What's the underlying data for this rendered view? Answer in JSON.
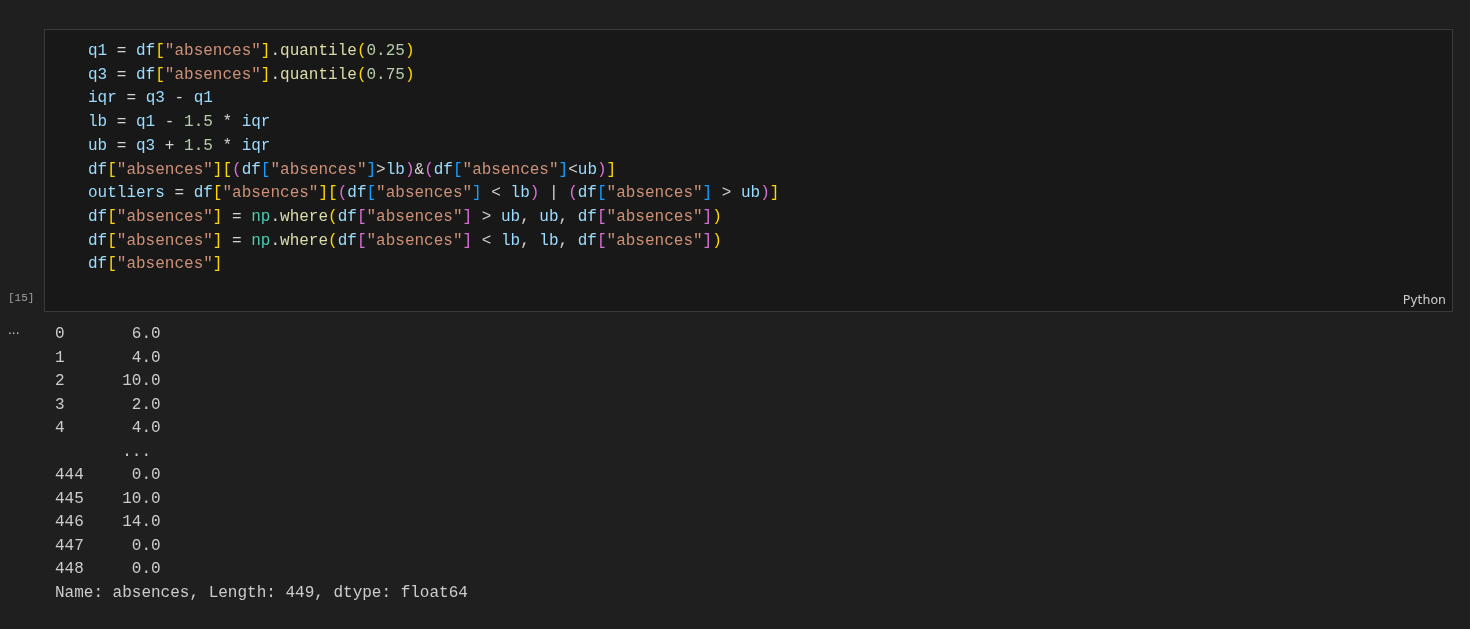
{
  "cell": {
    "execution_count": "[15]",
    "language": "Python",
    "lines": [
      [
        {
          "t": "q1",
          "kind": "name"
        },
        {
          "t": " = ",
          "kind": "op"
        },
        {
          "t": "df",
          "kind": "name"
        },
        {
          "t": "[",
          "kind": "bracket",
          "color": "#ffd700"
        },
        {
          "t": "\"absences\"",
          "kind": "str"
        },
        {
          "t": "]",
          "kind": "bracket",
          "color": "#ffd700"
        },
        {
          "t": ".",
          "kind": "op"
        },
        {
          "t": "quantile",
          "kind": "func"
        },
        {
          "t": "(",
          "kind": "bracket",
          "color": "#ffd700"
        },
        {
          "t": "0.25",
          "kind": "num"
        },
        {
          "t": ")",
          "kind": "bracket",
          "color": "#ffd700"
        }
      ],
      [
        {
          "t": "q3",
          "kind": "name"
        },
        {
          "t": " = ",
          "kind": "op"
        },
        {
          "t": "df",
          "kind": "name"
        },
        {
          "t": "[",
          "kind": "bracket",
          "color": "#ffd700"
        },
        {
          "t": "\"absences\"",
          "kind": "str"
        },
        {
          "t": "]",
          "kind": "bracket",
          "color": "#ffd700"
        },
        {
          "t": ".",
          "kind": "op"
        },
        {
          "t": "quantile",
          "kind": "func"
        },
        {
          "t": "(",
          "kind": "bracket",
          "color": "#ffd700"
        },
        {
          "t": "0.75",
          "kind": "num"
        },
        {
          "t": ")",
          "kind": "bracket",
          "color": "#ffd700"
        }
      ],
      [
        {
          "t": "iqr",
          "kind": "name"
        },
        {
          "t": " = ",
          "kind": "op"
        },
        {
          "t": "q3",
          "kind": "name"
        },
        {
          "t": " - ",
          "kind": "op"
        },
        {
          "t": "q1",
          "kind": "name"
        }
      ],
      [
        {
          "t": "lb",
          "kind": "name"
        },
        {
          "t": " = ",
          "kind": "op"
        },
        {
          "t": "q1",
          "kind": "name"
        },
        {
          "t": " - ",
          "kind": "op"
        },
        {
          "t": "1.5",
          "kind": "num"
        },
        {
          "t": " * ",
          "kind": "op"
        },
        {
          "t": "iqr",
          "kind": "name"
        }
      ],
      [
        {
          "t": "ub",
          "kind": "name"
        },
        {
          "t": " = ",
          "kind": "op"
        },
        {
          "t": "q3",
          "kind": "name"
        },
        {
          "t": " + ",
          "kind": "op"
        },
        {
          "t": "1.5",
          "kind": "num"
        },
        {
          "t": " * ",
          "kind": "op"
        },
        {
          "t": "iqr",
          "kind": "name"
        }
      ],
      [
        {
          "t": "df",
          "kind": "name"
        },
        {
          "t": "[",
          "kind": "bracket",
          "color": "#ffd700"
        },
        {
          "t": "\"absences\"",
          "kind": "str"
        },
        {
          "t": "]",
          "kind": "bracket",
          "color": "#ffd700"
        },
        {
          "t": "[",
          "kind": "bracket",
          "color": "#ffd700"
        },
        {
          "t": "(",
          "kind": "bracket",
          "color": "#da70d6"
        },
        {
          "t": "df",
          "kind": "name"
        },
        {
          "t": "[",
          "kind": "bracket",
          "color": "#179fff"
        },
        {
          "t": "\"absences\"",
          "kind": "str"
        },
        {
          "t": "]",
          "kind": "bracket",
          "color": "#179fff"
        },
        {
          "t": ">",
          "kind": "op"
        },
        {
          "t": "lb",
          "kind": "name"
        },
        {
          "t": ")",
          "kind": "bracket",
          "color": "#da70d6"
        },
        {
          "t": "&",
          "kind": "op"
        },
        {
          "t": "(",
          "kind": "bracket",
          "color": "#da70d6"
        },
        {
          "t": "df",
          "kind": "name"
        },
        {
          "t": "[",
          "kind": "bracket",
          "color": "#179fff"
        },
        {
          "t": "\"absences\"",
          "kind": "str"
        },
        {
          "t": "]",
          "kind": "bracket",
          "color": "#179fff"
        },
        {
          "t": "<",
          "kind": "op"
        },
        {
          "t": "ub",
          "kind": "name"
        },
        {
          "t": ")",
          "kind": "bracket",
          "color": "#da70d6"
        },
        {
          "t": "]",
          "kind": "bracket",
          "color": "#ffd700"
        }
      ],
      [
        {
          "t": "outliers",
          "kind": "name"
        },
        {
          "t": " = ",
          "kind": "op"
        },
        {
          "t": "df",
          "kind": "name"
        },
        {
          "t": "[",
          "kind": "bracket",
          "color": "#ffd700"
        },
        {
          "t": "\"absences\"",
          "kind": "str"
        },
        {
          "t": "]",
          "kind": "bracket",
          "color": "#ffd700"
        },
        {
          "t": "[",
          "kind": "bracket",
          "color": "#ffd700"
        },
        {
          "t": "(",
          "kind": "bracket",
          "color": "#da70d6"
        },
        {
          "t": "df",
          "kind": "name"
        },
        {
          "t": "[",
          "kind": "bracket",
          "color": "#179fff"
        },
        {
          "t": "\"absences\"",
          "kind": "str"
        },
        {
          "t": "]",
          "kind": "bracket",
          "color": "#179fff"
        },
        {
          "t": " < ",
          "kind": "op"
        },
        {
          "t": "lb",
          "kind": "name"
        },
        {
          "t": ")",
          "kind": "bracket",
          "color": "#da70d6"
        },
        {
          "t": " | ",
          "kind": "op"
        },
        {
          "t": "(",
          "kind": "bracket",
          "color": "#da70d6"
        },
        {
          "t": "df",
          "kind": "name"
        },
        {
          "t": "[",
          "kind": "bracket",
          "color": "#179fff"
        },
        {
          "t": "\"absences\"",
          "kind": "str"
        },
        {
          "t": "]",
          "kind": "bracket",
          "color": "#179fff"
        },
        {
          "t": " > ",
          "kind": "op"
        },
        {
          "t": "ub",
          "kind": "name"
        },
        {
          "t": ")",
          "kind": "bracket",
          "color": "#da70d6"
        },
        {
          "t": "]",
          "kind": "bracket",
          "color": "#ffd700"
        }
      ],
      [
        {
          "t": "df",
          "kind": "name"
        },
        {
          "t": "[",
          "kind": "bracket",
          "color": "#ffd700"
        },
        {
          "t": "\"absences\"",
          "kind": "str"
        },
        {
          "t": "]",
          "kind": "bracket",
          "color": "#ffd700"
        },
        {
          "t": " = ",
          "kind": "op"
        },
        {
          "t": "np",
          "kind": "module"
        },
        {
          "t": ".",
          "kind": "op"
        },
        {
          "t": "where",
          "kind": "func"
        },
        {
          "t": "(",
          "kind": "bracket",
          "color": "#ffd700"
        },
        {
          "t": "df",
          "kind": "name"
        },
        {
          "t": "[",
          "kind": "bracket",
          "color": "#da70d6"
        },
        {
          "t": "\"absences\"",
          "kind": "str"
        },
        {
          "t": "]",
          "kind": "bracket",
          "color": "#da70d6"
        },
        {
          "t": " > ",
          "kind": "op"
        },
        {
          "t": "ub",
          "kind": "name"
        },
        {
          "t": ", ",
          "kind": "op"
        },
        {
          "t": "ub",
          "kind": "name"
        },
        {
          "t": ", ",
          "kind": "op"
        },
        {
          "t": "df",
          "kind": "name"
        },
        {
          "t": "[",
          "kind": "bracket",
          "color": "#da70d6"
        },
        {
          "t": "\"absences\"",
          "kind": "str"
        },
        {
          "t": "]",
          "kind": "bracket",
          "color": "#da70d6"
        },
        {
          "t": ")",
          "kind": "bracket",
          "color": "#ffd700"
        }
      ],
      [
        {
          "t": "df",
          "kind": "name"
        },
        {
          "t": "[",
          "kind": "bracket",
          "color": "#ffd700"
        },
        {
          "t": "\"absences\"",
          "kind": "str"
        },
        {
          "t": "]",
          "kind": "bracket",
          "color": "#ffd700"
        },
        {
          "t": " = ",
          "kind": "op"
        },
        {
          "t": "np",
          "kind": "module"
        },
        {
          "t": ".",
          "kind": "op"
        },
        {
          "t": "where",
          "kind": "func"
        },
        {
          "t": "(",
          "kind": "bracket",
          "color": "#ffd700"
        },
        {
          "t": "df",
          "kind": "name"
        },
        {
          "t": "[",
          "kind": "bracket",
          "color": "#da70d6"
        },
        {
          "t": "\"absences\"",
          "kind": "str"
        },
        {
          "t": "]",
          "kind": "bracket",
          "color": "#da70d6"
        },
        {
          "t": " < ",
          "kind": "op"
        },
        {
          "t": "lb",
          "kind": "name"
        },
        {
          "t": ", ",
          "kind": "op"
        },
        {
          "t": "lb",
          "kind": "name"
        },
        {
          "t": ", ",
          "kind": "op"
        },
        {
          "t": "df",
          "kind": "name"
        },
        {
          "t": "[",
          "kind": "bracket",
          "color": "#da70d6"
        },
        {
          "t": "\"absences\"",
          "kind": "str"
        },
        {
          "t": "]",
          "kind": "bracket",
          "color": "#da70d6"
        },
        {
          "t": ")",
          "kind": "bracket",
          "color": "#ffd700"
        }
      ],
      [
        {
          "t": "df",
          "kind": "name"
        },
        {
          "t": "[",
          "kind": "bracket",
          "color": "#ffd700"
        },
        {
          "t": "\"absences\"",
          "kind": "str"
        },
        {
          "t": "]",
          "kind": "bracket",
          "color": "#ffd700"
        }
      ]
    ]
  },
  "output": {
    "toggle": "...",
    "lines": [
      "0       6.0",
      "1       4.0",
      "2      10.0",
      "3       2.0",
      "4       4.0",
      "       ...",
      "444     0.0",
      "445    10.0",
      "446    14.0",
      "447     0.0",
      "448     0.0",
      "Name: absences, Length: 449, dtype: float64"
    ]
  }
}
